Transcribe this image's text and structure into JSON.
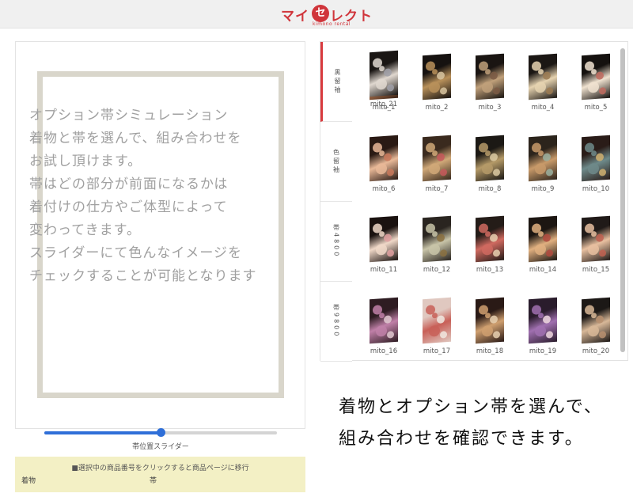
{
  "header": {
    "logo_left": "マイ",
    "logo_circle": "セ",
    "logo_right": "レクト",
    "logo_sub": "kimono rental"
  },
  "simulation": {
    "lines": [
      "オプション帯シミュレーション",
      "着物と帯を選んで、組み合わせを",
      "お試し頂けます。",
      "帯はどの部分が前面になるかは",
      "着付けの仕方やご体型によって",
      "変わってきます。",
      "スライダーにて色んなイメージを",
      "チェックすることが可能となります"
    ]
  },
  "slider": {
    "label": "帯位置スライダー",
    "value_fraction": 0.5
  },
  "selection": {
    "instruction": "■選択中の商品番号をクリックすると商品ページに移行",
    "kimono_label": "着物",
    "obi_label": "帯"
  },
  "tabs": [
    {
      "label": "黒留袖",
      "active": true
    },
    {
      "label": "色留袖",
      "active": false
    },
    {
      "label": "帯4800",
      "active": false
    },
    {
      "label": "帯9800",
      "active": false
    }
  ],
  "items": [
    {
      "label": "mito_1",
      "colors": [
        "#3b2418",
        "#c9865a",
        "#e8c9a0"
      ]
    },
    {
      "label": "mito_2",
      "colors": [
        "#161210",
        "#b8905a",
        "#d8c4a0"
      ]
    },
    {
      "label": "mito_3",
      "colors": [
        "#1a1512",
        "#c0a07a",
        "#7b5b44"
      ]
    },
    {
      "label": "mito_4",
      "colors": [
        "#1b1714",
        "#e6d3b0",
        "#9c7b52"
      ]
    },
    {
      "label": "mito_5",
      "colors": [
        "#15110f",
        "#f0e2d0",
        "#c06a5e"
      ]
    },
    {
      "label": "mito_6",
      "colors": [
        "#2a1a14",
        "#e9b998",
        "#c9785a"
      ]
    },
    {
      "label": "mito_7",
      "colors": [
        "#3a2a1e",
        "#d0a878",
        "#c6585a"
      ]
    },
    {
      "label": "mito_8",
      "colors": [
        "#1c1915",
        "#b59a68",
        "#dccaa2"
      ]
    },
    {
      "label": "mito_9",
      "colors": [
        "#2c241c",
        "#c89a6a",
        "#9ab0a0"
      ]
    },
    {
      "label": "mito_10",
      "colors": [
        "#2a1c18",
        "#6e8a8a",
        "#d0b070"
      ]
    },
    {
      "label": "mito_11",
      "colors": [
        "#1a1210",
        "#f0d8c8",
        "#e0a0a0"
      ]
    },
    {
      "label": "mito_12",
      "colors": [
        "#2a2520",
        "#c8c4a8",
        "#8a7040"
      ]
    },
    {
      "label": "mito_13",
      "colors": [
        "#241c18",
        "#d06a60",
        "#e8d0b0"
      ]
    },
    {
      "label": "mito_14",
      "colors": [
        "#1c1612",
        "#e0b080",
        "#b04a3e"
      ]
    },
    {
      "label": "mito_15",
      "colors": [
        "#201a18",
        "#e8c0a0",
        "#c06050"
      ]
    },
    {
      "label": "mito_16",
      "colors": [
        "#2e1c22",
        "#c080a8",
        "#e0c8d0"
      ]
    },
    {
      "label": "mito_17",
      "colors": [
        "#e0c8c0",
        "#c86058",
        "#f0e8e0"
      ]
    },
    {
      "label": "mito_18",
      "colors": [
        "#2a1a16",
        "#d0a070",
        "#e8d0b0"
      ]
    },
    {
      "label": "mito_19",
      "colors": [
        "#2a1c2c",
        "#a070b0",
        "#f0d8e0"
      ]
    },
    {
      "label": "mito_20",
      "colors": [
        "#1c1816",
        "#d8b898",
        "#b89070"
      ]
    },
    {
      "label": "mito_21",
      "colors": [
        "#1a1614",
        "#e0d8d0",
        "#a0a0a8"
      ]
    }
  ],
  "caption": {
    "line1": "着物とオプション帯を選んで、",
    "line2": "組み合わせを確認できます。"
  }
}
